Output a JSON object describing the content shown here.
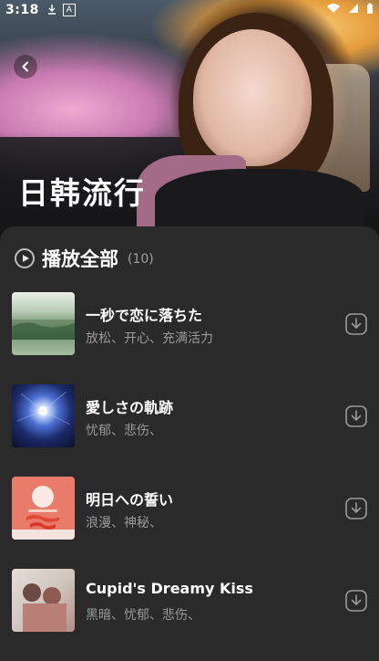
{
  "status_bar": {
    "time": "3:18",
    "icons": [
      "download-indicator-icon",
      "a-notification-icon",
      "wifi-icon",
      "signal-icon",
      "battery-icon"
    ]
  },
  "header": {
    "title": "日韩流行",
    "back_icon": "chevron-left-icon"
  },
  "play_all": {
    "label": "播放全部",
    "count": "(10)"
  },
  "tracks": [
    {
      "title": "一秒で恋に落ちた",
      "tags": "放松、开心、充满活力",
      "cover": "lake-forest"
    },
    {
      "title": "愛しさの軌跡",
      "tags": "忧郁、悲伤、",
      "cover": "blue-light"
    },
    {
      "title": "明日への誓い",
      "tags": "浪漫、神秘、",
      "cover": "red-sunset"
    },
    {
      "title": "Cupid's Dreamy Kiss",
      "tags": "黑暗、忧郁、悲伤、",
      "cover": "couple-photo"
    }
  ],
  "colors": {
    "background": "#2a2a2a",
    "title_text": "#ffffff",
    "secondary_text": "#9a9a9a"
  }
}
